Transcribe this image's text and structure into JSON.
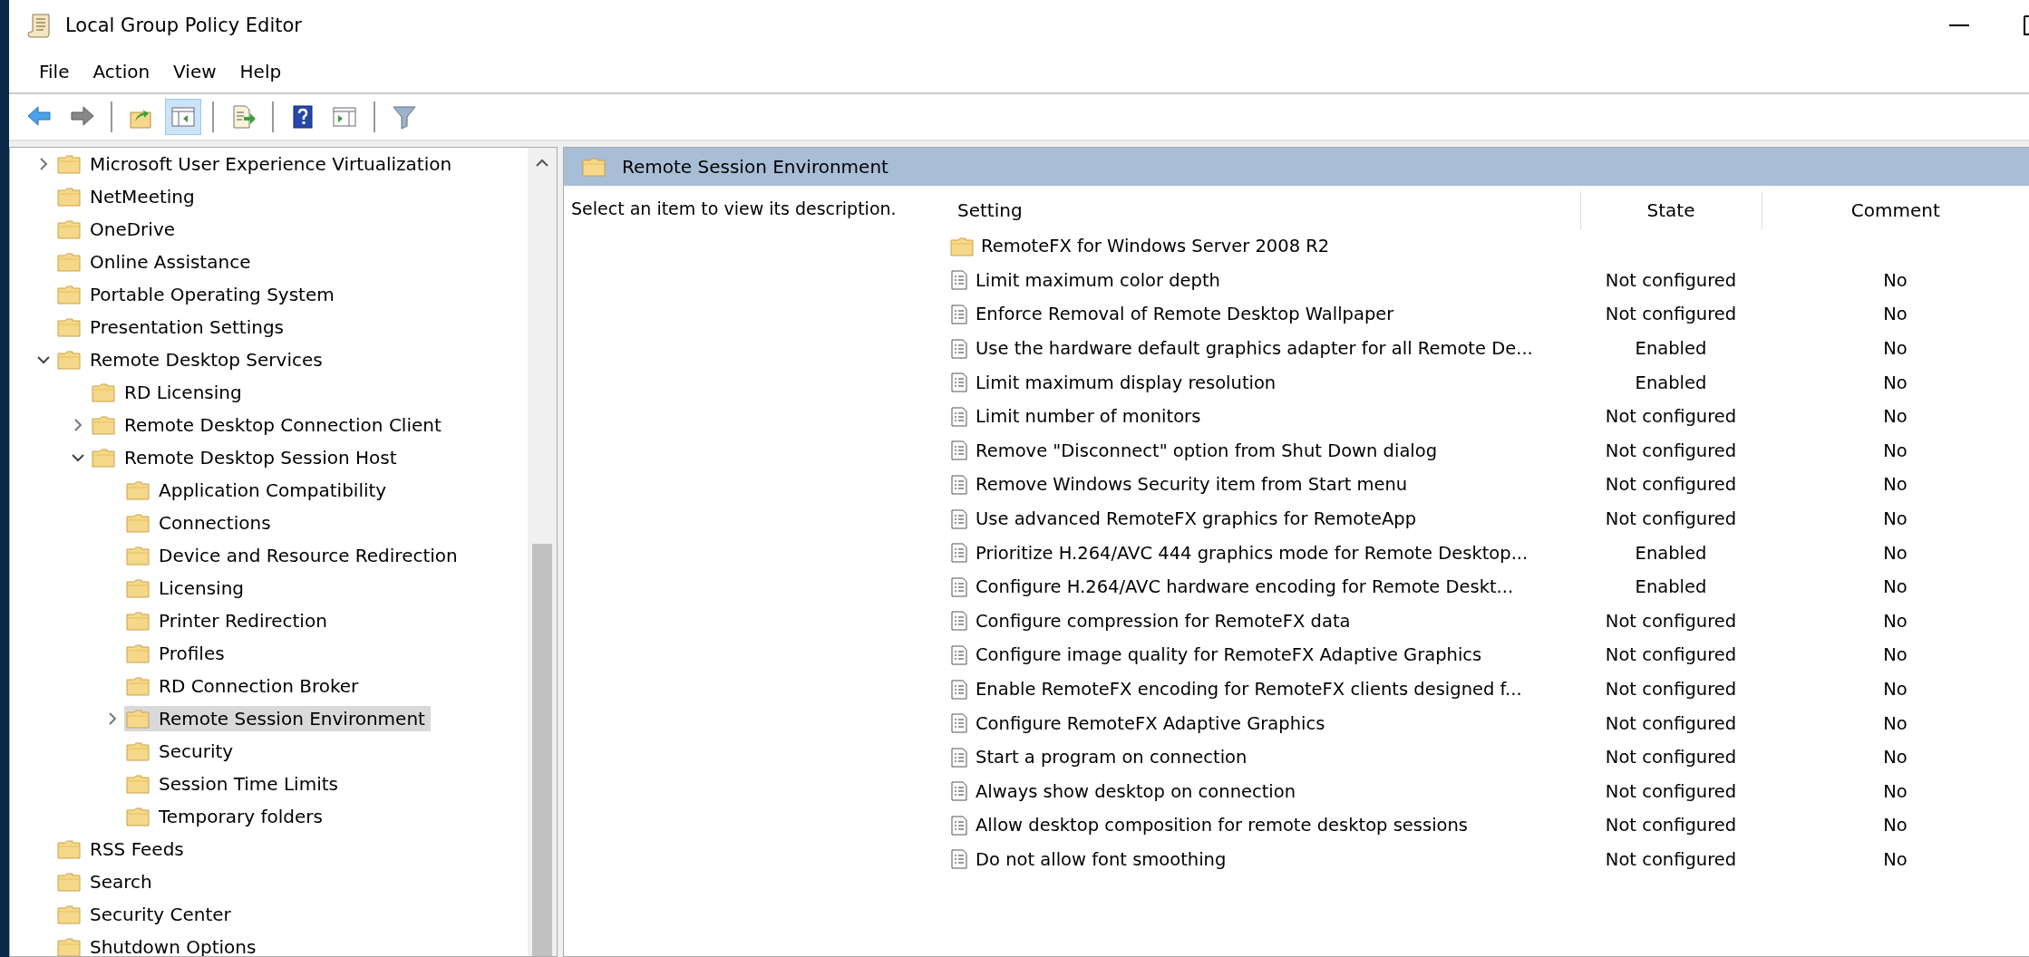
{
  "window": {
    "title": "Local Group Policy Editor"
  },
  "menu": [
    "File",
    "Action",
    "View",
    "Help"
  ],
  "toolbar": [
    [
      {
        "kind": "back",
        "selected": false
      },
      {
        "kind": "forward",
        "selected": false
      }
    ],
    [
      {
        "kind": "up",
        "selected": false
      },
      {
        "kind": "tree",
        "selected": true
      }
    ],
    [
      {
        "kind": "export",
        "selected": false
      }
    ],
    [
      {
        "kind": "help",
        "selected": false
      },
      {
        "kind": "pane",
        "selected": false
      }
    ],
    [
      {
        "kind": "filter",
        "selected": false
      }
    ]
  ],
  "tree": [
    {
      "label": "Microsoft User Experience Virtualization",
      "expandable": true,
      "expanded": false,
      "selected": false
    },
    {
      "label": "NetMeeting",
      "expandable": false,
      "selected": false
    },
    {
      "label": "OneDrive",
      "expandable": false,
      "selected": false
    },
    {
      "label": "Online Assistance",
      "expandable": false,
      "selected": false
    },
    {
      "label": "Portable Operating System",
      "expandable": false,
      "selected": false
    },
    {
      "label": "Presentation Settings",
      "expandable": false,
      "selected": false
    },
    {
      "label": "Remote Desktop Services",
      "expandable": true,
      "expanded": true,
      "selected": false,
      "children": [
        {
          "label": "RD Licensing",
          "expandable": false,
          "selected": false
        },
        {
          "label": "Remote Desktop Connection Client",
          "expandable": true,
          "expanded": false,
          "selected": false
        },
        {
          "label": "Remote Desktop Session Host",
          "expandable": true,
          "expanded": true,
          "selected": false,
          "children": [
            {
              "label": "Application Compatibility",
              "expandable": false,
              "selected": false
            },
            {
              "label": "Connections",
              "expandable": false,
              "selected": false
            },
            {
              "label": "Device and Resource Redirection",
              "expandable": false,
              "selected": false
            },
            {
              "label": "Licensing",
              "expandable": false,
              "selected": false
            },
            {
              "label": "Printer Redirection",
              "expandable": false,
              "selected": false
            },
            {
              "label": "Profiles",
              "expandable": false,
              "selected": false
            },
            {
              "label": "RD Connection Broker",
              "expandable": false,
              "selected": false
            },
            {
              "label": "Remote Session Environment",
              "expandable": true,
              "expanded": false,
              "selected": true
            },
            {
              "label": "Security",
              "expandable": false,
              "selected": false
            },
            {
              "label": "Session Time Limits",
              "expandable": false,
              "selected": false
            },
            {
              "label": "Temporary folders",
              "expandable": false,
              "selected": false
            }
          ]
        }
      ]
    },
    {
      "label": "RSS Feeds",
      "expandable": false,
      "selected": false
    },
    {
      "label": "Search",
      "expandable": false,
      "selected": false
    },
    {
      "label": "Security Center",
      "expandable": false,
      "selected": false
    },
    {
      "label": "Shutdown Options",
      "expandable": false,
      "selected": false
    }
  ],
  "details": {
    "title": "Remote Session Environment",
    "description": "Select an item to view its description.",
    "table": {
      "columns": [
        "Setting",
        "State",
        "Comment"
      ],
      "rows": [
        {
          "kind": "folder",
          "setting": "RemoteFX for Windows Server 2008 R2"
        },
        {
          "kind": "policy",
          "setting": "Limit maximum color depth",
          "state": "Not configured",
          "comment": "No"
        },
        {
          "kind": "policy",
          "setting": "Enforce Removal of Remote Desktop Wallpaper",
          "state": "Not configured",
          "comment": "No"
        },
        {
          "kind": "policy",
          "setting": "Use the hardware default graphics adapter for all Remote De...",
          "state": "Enabled",
          "comment": "No"
        },
        {
          "kind": "policy",
          "setting": "Limit maximum display resolution",
          "state": "Enabled",
          "comment": "No"
        },
        {
          "kind": "policy",
          "setting": "Limit number of monitors",
          "state": "Not configured",
          "comment": "No"
        },
        {
          "kind": "policy",
          "setting": "Remove \"Disconnect\" option from Shut Down dialog",
          "state": "Not configured",
          "comment": "No"
        },
        {
          "kind": "policy",
          "setting": "Remove Windows Security item from Start menu",
          "state": "Not configured",
          "comment": "No"
        },
        {
          "kind": "policy",
          "setting": "Use advanced RemoteFX graphics for RemoteApp",
          "state": "Not configured",
          "comment": "No"
        },
        {
          "kind": "policy",
          "setting": "Prioritize H.264/AVC 444 graphics mode for Remote Desktop...",
          "state": "Enabled",
          "comment": "No"
        },
        {
          "kind": "policy",
          "setting": "Configure H.264/AVC hardware encoding for Remote Deskt...",
          "state": "Enabled",
          "comment": "No"
        },
        {
          "kind": "policy",
          "setting": "Configure compression for RemoteFX data",
          "state": "Not configured",
          "comment": "No"
        },
        {
          "kind": "policy",
          "setting": "Configure image quality for RemoteFX Adaptive Graphics",
          "state": "Not configured",
          "comment": "No"
        },
        {
          "kind": "policy",
          "setting": "Enable RemoteFX encoding for RemoteFX clients designed f...",
          "state": "Not configured",
          "comment": "No"
        },
        {
          "kind": "policy",
          "setting": "Configure RemoteFX Adaptive Graphics",
          "state": "Not configured",
          "comment": "No"
        },
        {
          "kind": "policy",
          "setting": "Start a program on connection",
          "state": "Not configured",
          "comment": "No"
        },
        {
          "kind": "policy",
          "setting": "Always show desktop on connection",
          "state": "Not configured",
          "comment": "No"
        },
        {
          "kind": "policy",
          "setting": "Allow desktop composition for remote desktop sessions",
          "state": "Not configured",
          "comment": "No"
        },
        {
          "kind": "policy",
          "setting": "Do not allow font smoothing",
          "state": "Not configured",
          "comment": "No"
        }
      ]
    }
  }
}
